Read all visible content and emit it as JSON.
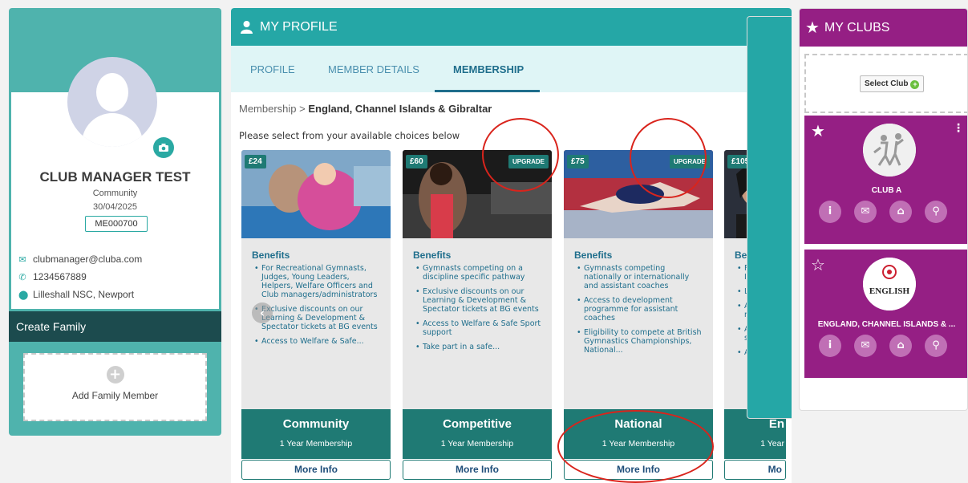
{
  "profile": {
    "name": "CLUB MANAGER TEST",
    "type": "Community",
    "date": "30/04/2025",
    "member_id": "ME000700",
    "email": "clubmanager@cluba.com",
    "phone": "1234567889",
    "location": "Lilleshall NSC, Newport"
  },
  "family": {
    "header": "Create Family",
    "add_label": "Add Family Member"
  },
  "main": {
    "title": "MY PROFILE",
    "tabs": [
      {
        "label": "PROFILE"
      },
      {
        "label": "MEMBER DETAILS"
      },
      {
        "label": "MEMBERSHIP",
        "active": true
      }
    ],
    "breadcrumb_root": "Membership",
    "breadcrumb_sep": ">",
    "breadcrumb_current": "England, Channel Islands & Gibraltar",
    "instructions": "Please select from your available choices below",
    "upgrade_label": "UPGRADE",
    "benefits_title": "Benefits",
    "more_info_label": "More Info",
    "cards": [
      {
        "price": "£24",
        "name": "Community",
        "duration": "1 Year Membership",
        "benefits": [
          "For Recreational Gymnasts, Judges, Young Leaders, Helpers, Welfare Officers and Club managers/administrators",
          "Exclusive discounts on our Learning & Development & Spectator tickets at BG events",
          "Access to Welfare & Safe..."
        ]
      },
      {
        "price": "£60",
        "upgrade": true,
        "name": "Competitive",
        "duration": "1 Year Membership",
        "benefits": [
          "Gymnasts competing on a discipline specific pathway",
          "Exclusive discounts on our Learning & Development & Spectator tickets at BG events",
          "Access to Welfare & Safe Sport support",
          "Take part in a safe..."
        ]
      },
      {
        "price": "£75",
        "upgrade": true,
        "name": "National",
        "duration": "1 Year Membership",
        "benefits": [
          "Gymnasts competing nationally or internationally and assistant coaches",
          "Access to development programme for assistant coaches",
          "Eligibility to compete at British Gymnastics Championships, National..."
        ]
      },
      {
        "price": "£105",
        "name": "En",
        "duration": "1 Year",
        "benefits": [
          "For Coacl Instructo",
          "Loss of e",
          "Access to resource",
          "Access to symposiu",
          "AGM voti"
        ]
      }
    ]
  },
  "clubs": {
    "title": "MY CLUBS",
    "select_label": "Select Club",
    "items": [
      {
        "name": "CLUB A",
        "starred": true
      },
      {
        "name": "ENGLAND, CHANNEL ISLANDS & ...",
        "starred": false,
        "logo_text": "ENGLISH"
      }
    ]
  },
  "colors": {
    "teal": "#25a7a6",
    "dark_teal": "#1f7a74",
    "purple": "#951f84",
    "annotation_red": "#d9241c"
  }
}
